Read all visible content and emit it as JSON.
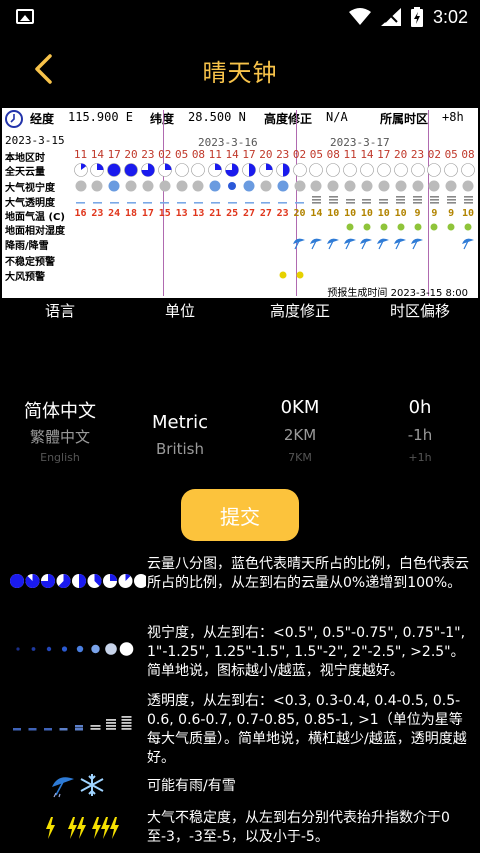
{
  "status_bar": {
    "time": "3:02"
  },
  "header": {
    "title": "晴天钟"
  },
  "chart": {
    "longitude_label": "经度",
    "longitude_value": "115.900 E",
    "latitude_label": "纬度",
    "latitude_value": "28.500 N",
    "altitude_label": "高度修正",
    "altitude_value": "N/A",
    "timezone_label": "所属时区",
    "timezone_value": "+8h",
    "date1": "2023-3-15",
    "date2": "2023-3-16",
    "date3": "2023-3-17",
    "row_labels": [
      "本地区时",
      "全天云量",
      "大气视宁度",
      "大气透明度",
      "地面气温 (C)",
      "地面相对湿度",
      "降雨/降雪",
      "不稳定预警",
      "大风预警"
    ],
    "hours": [
      "11",
      "14",
      "17",
      "20",
      "23",
      "02",
      "05",
      "08",
      "11",
      "14",
      "17",
      "20",
      "23",
      "02",
      "05",
      "08",
      "11",
      "14",
      "17",
      "20",
      "23",
      "02",
      "05",
      "08"
    ],
    "temps": [
      "16",
      "23",
      "24",
      "18",
      "17",
      "15",
      "13",
      "13",
      "21",
      "25",
      "27",
      "27",
      "23",
      "20",
      "14",
      "10",
      "10",
      "10",
      "10",
      "10",
      "9",
      "9",
      "9",
      "10"
    ],
    "cloud_fraction": [
      0.15,
      0.25,
      1,
      1,
      0.75,
      0.25,
      0,
      0,
      0.25,
      0.75,
      0.5,
      0.25,
      0.5,
      0,
      0,
      0,
      0,
      0,
      0,
      0,
      0,
      0,
      0,
      0
    ],
    "seeing_level": [
      0,
      0,
      1,
      0,
      0,
      0,
      0,
      0,
      1,
      2,
      1,
      0,
      1,
      0,
      0,
      0,
      0,
      0,
      0,
      0,
      0,
      0,
      0,
      0
    ],
    "transparency_level": [
      0,
      0,
      0,
      0,
      0,
      0,
      0,
      0,
      0,
      0,
      0,
      0,
      0,
      0,
      3,
      3,
      2,
      2,
      2,
      3,
      3,
      3,
      3,
      3
    ],
    "humidity_flags": [
      0,
      0,
      0,
      0,
      0,
      0,
      0,
      0,
      0,
      0,
      0,
      0,
      0,
      0,
      0,
      0,
      1,
      1,
      1,
      1,
      1,
      1,
      1,
      1
    ],
    "rain_flags": [
      0,
      0,
      0,
      0,
      0,
      0,
      0,
      0,
      0,
      0,
      0,
      0,
      0,
      1,
      1,
      1,
      1,
      1,
      1,
      1,
      1,
      0,
      0,
      1
    ],
    "wind_flags": [
      0,
      0,
      0,
      0,
      0,
      0,
      0,
      0,
      0,
      0,
      0,
      0,
      1,
      1,
      0,
      0,
      0,
      0,
      0,
      0,
      0,
      0,
      0,
      0
    ],
    "generated_time": "预报生成时间 2023-3-15 8:00"
  },
  "options": {
    "language": {
      "heading": "语言",
      "selected": "简体中文",
      "next": "繁體中文",
      "far": "English"
    },
    "unit": {
      "heading": "单位",
      "selected": "Metric",
      "next": "British"
    },
    "altitude": {
      "heading": "高度修正",
      "selected": "0KM",
      "next": "2KM",
      "far": "7KM"
    },
    "timezone": {
      "heading": "时区偏移",
      "selected": "0h",
      "next": "-1h",
      "far": "+1h"
    }
  },
  "submit_label": "提交",
  "legend": {
    "cloud": "云量八分图，蓝色代表晴天所占的比例，白色代表云所占的比例，从左到右的云量从0%递增到100%。",
    "seeing": "视宁度，从左到右：<0.5\", 0.5\"-0.75\", 0.75\"-1\", 1\"-1.25\", 1.25\"-1.5\", 1.5\"-2\", 2\"-2.5\", >2.5\"。简单地说，图标越小/越蓝，视宁度越好。",
    "transparency": "透明度，从左到右：<0.3, 0.3-0.4, 0.4-0.5, 0.5-0.6, 0.6-0.7, 0.7-0.85, 0.85-1, >1（单位为星等每大气质量）。简单地说，横杠越少/越蓝，透明度越好。",
    "rain_snow": "可能有雨/有雪",
    "instability": "大气不稳定度，从左到右分别代表抬升指数介于0至-3，-3至-5，以及小于-5。"
  },
  "colors": {
    "accent": "#fcc33c",
    "title": "#f8c34a",
    "clear_blue": "#1a1aee",
    "grid_line": "#b06ab0"
  }
}
